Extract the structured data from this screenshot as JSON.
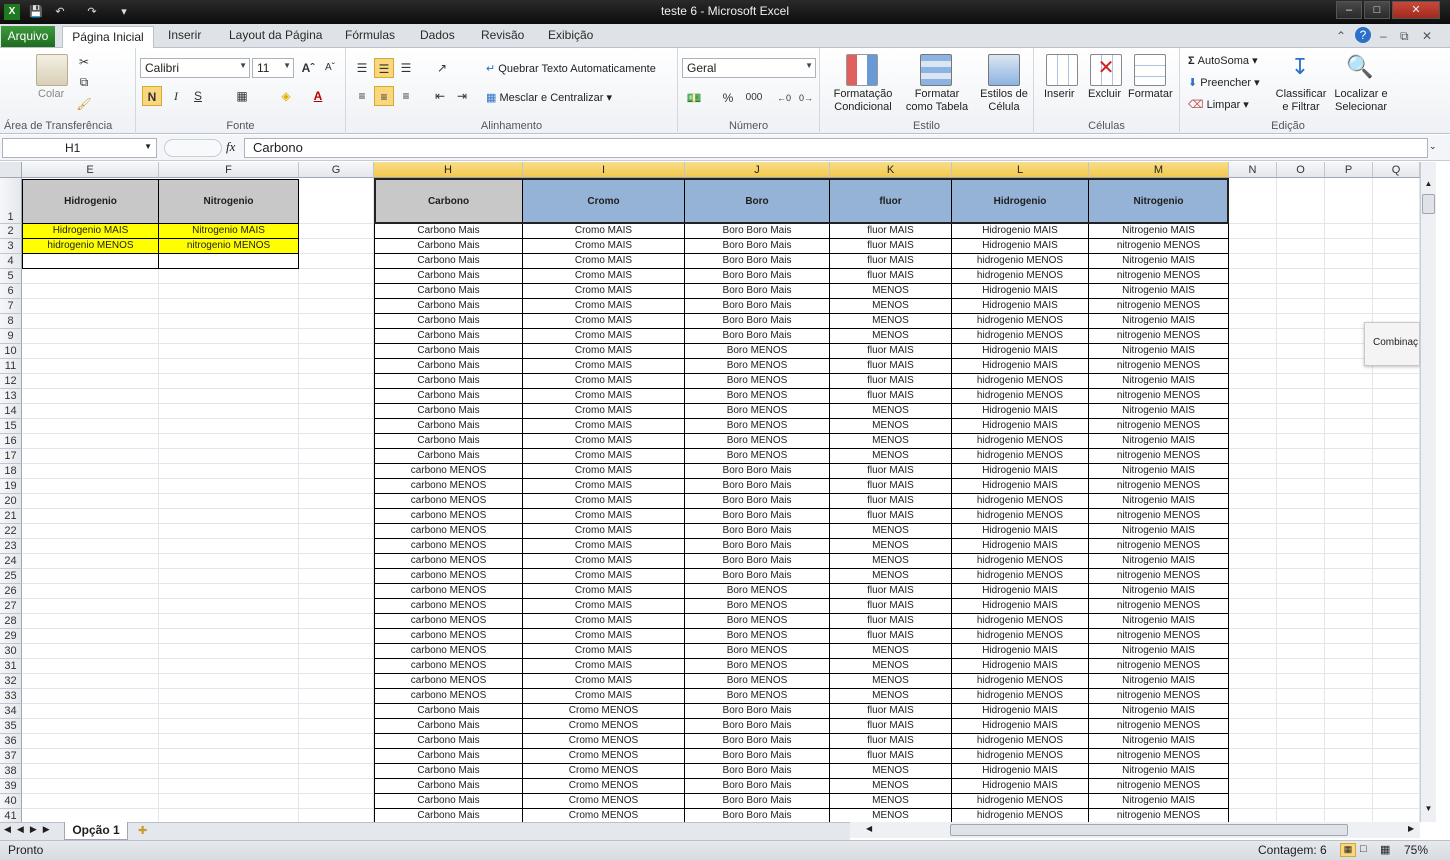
{
  "window": {
    "title": "teste 6  -  Microsoft Excel"
  },
  "tabs": [
    "Arquivo",
    "Página Inicial",
    "Inserir",
    "Layout da Página",
    "Fórmulas",
    "Dados",
    "Revisão",
    "Exibição"
  ],
  "ribbon": {
    "clipboard": {
      "label": "Área de Transferência",
      "paste": "Colar"
    },
    "font": {
      "label": "Fonte",
      "name": "Calibri",
      "size": "11",
      "bold": "N",
      "italic": "I",
      "underline": "S"
    },
    "alignment": {
      "label": "Alinhamento",
      "wrap": "Quebrar Texto Automaticamente",
      "merge": "Mesclar e Centralizar"
    },
    "number": {
      "label": "Número",
      "format": "Geral",
      "percent": "%",
      "thousands": "000"
    },
    "styles": {
      "label": "Estilo",
      "cond": [
        "Formatação",
        "Condicional"
      ],
      "table": [
        "Formatar",
        "como Tabela"
      ],
      "cell": [
        "Estilos de",
        "Célula"
      ]
    },
    "cells": {
      "label": "Células",
      "insert": "Inserir",
      "delete": "Excluir",
      "format": "Formatar"
    },
    "editing": {
      "label": "Edição",
      "autosum": "AutoSoma",
      "fill": "Preencher",
      "clear": "Limpar",
      "sort": [
        "Classificar",
        "e Filtrar"
      ],
      "find": [
        "Localizar e",
        "Selecionar"
      ]
    }
  },
  "formula_bar": {
    "name_box": "H1",
    "fx": "fx",
    "value": "Carbono"
  },
  "columns": [
    "E",
    "F",
    "G",
    "H",
    "I",
    "J",
    "K",
    "L",
    "M",
    "N",
    "O",
    "P",
    "Q"
  ],
  "left_table": {
    "headers": [
      "Hidrogenio",
      "Nitrogenio"
    ],
    "rows": [
      [
        "Hidrogenio MAIS",
        "Nitrogenio MAIS"
      ],
      [
        "hidrogenio MENOS",
        "nitrogenio MENOS"
      ]
    ]
  },
  "main_table": {
    "headers": [
      "Carbono",
      "Cromo",
      "Boro",
      "fluor",
      "Hidrogenio",
      "Nitrogenio"
    ],
    "rows": [
      [
        "Carbono Mais",
        "Cromo  MAIS",
        "Boro Boro Mais",
        "fluor MAIS",
        "Hidrogenio MAIS",
        "Nitrogenio MAIS"
      ],
      [
        "Carbono Mais",
        "Cromo  MAIS",
        "Boro Boro Mais",
        "fluor MAIS",
        "Hidrogenio MAIS",
        "nitrogenio MENOS"
      ],
      [
        "Carbono Mais",
        "Cromo  MAIS",
        "Boro Boro Mais",
        "fluor MAIS",
        "hidrogenio MENOS",
        "Nitrogenio MAIS"
      ],
      [
        "Carbono Mais",
        "Cromo  MAIS",
        "Boro Boro Mais",
        "fluor MAIS",
        "hidrogenio MENOS",
        "nitrogenio MENOS"
      ],
      [
        "Carbono Mais",
        "Cromo  MAIS",
        "Boro Boro Mais",
        "MENOS",
        "Hidrogenio MAIS",
        "Nitrogenio MAIS"
      ],
      [
        "Carbono Mais",
        "Cromo  MAIS",
        "Boro Boro Mais",
        "MENOS",
        "Hidrogenio MAIS",
        "nitrogenio MENOS"
      ],
      [
        "Carbono Mais",
        "Cromo  MAIS",
        "Boro Boro Mais",
        "MENOS",
        "hidrogenio MENOS",
        "Nitrogenio MAIS"
      ],
      [
        "Carbono Mais",
        "Cromo  MAIS",
        "Boro Boro Mais",
        "MENOS",
        "hidrogenio MENOS",
        "nitrogenio MENOS"
      ],
      [
        "Carbono Mais",
        "Cromo  MAIS",
        "Boro MENOS",
        "fluor MAIS",
        "Hidrogenio MAIS",
        "Nitrogenio MAIS"
      ],
      [
        "Carbono Mais",
        "Cromo  MAIS",
        "Boro MENOS",
        "fluor MAIS",
        "Hidrogenio MAIS",
        "nitrogenio MENOS"
      ],
      [
        "Carbono Mais",
        "Cromo  MAIS",
        "Boro MENOS",
        "fluor MAIS",
        "hidrogenio MENOS",
        "Nitrogenio MAIS"
      ],
      [
        "Carbono Mais",
        "Cromo  MAIS",
        "Boro MENOS",
        "fluor MAIS",
        "hidrogenio MENOS",
        "nitrogenio MENOS"
      ],
      [
        "Carbono Mais",
        "Cromo  MAIS",
        "Boro MENOS",
        "MENOS",
        "Hidrogenio MAIS",
        "Nitrogenio MAIS"
      ],
      [
        "Carbono Mais",
        "Cromo  MAIS",
        "Boro MENOS",
        "MENOS",
        "Hidrogenio MAIS",
        "nitrogenio MENOS"
      ],
      [
        "Carbono Mais",
        "Cromo  MAIS",
        "Boro MENOS",
        "MENOS",
        "hidrogenio MENOS",
        "Nitrogenio MAIS"
      ],
      [
        "Carbono Mais",
        "Cromo  MAIS",
        "Boro MENOS",
        "MENOS",
        "hidrogenio MENOS",
        "nitrogenio MENOS"
      ],
      [
        "carbono MENOS",
        "Cromo  MAIS",
        "Boro Boro Mais",
        "fluor MAIS",
        "Hidrogenio MAIS",
        "Nitrogenio MAIS"
      ],
      [
        "carbono MENOS",
        "Cromo  MAIS",
        "Boro Boro Mais",
        "fluor MAIS",
        "Hidrogenio MAIS",
        "nitrogenio MENOS"
      ],
      [
        "carbono MENOS",
        "Cromo  MAIS",
        "Boro Boro Mais",
        "fluor MAIS",
        "hidrogenio MENOS",
        "Nitrogenio MAIS"
      ],
      [
        "carbono MENOS",
        "Cromo  MAIS",
        "Boro Boro Mais",
        "fluor MAIS",
        "hidrogenio MENOS",
        "nitrogenio MENOS"
      ],
      [
        "carbono MENOS",
        "Cromo  MAIS",
        "Boro Boro Mais",
        "MENOS",
        "Hidrogenio MAIS",
        "Nitrogenio MAIS"
      ],
      [
        "carbono MENOS",
        "Cromo  MAIS",
        "Boro Boro Mais",
        "MENOS",
        "Hidrogenio MAIS",
        "nitrogenio MENOS"
      ],
      [
        "carbono MENOS",
        "Cromo  MAIS",
        "Boro Boro Mais",
        "MENOS",
        "hidrogenio MENOS",
        "Nitrogenio MAIS"
      ],
      [
        "carbono MENOS",
        "Cromo  MAIS",
        "Boro Boro Mais",
        "MENOS",
        "hidrogenio MENOS",
        "nitrogenio MENOS"
      ],
      [
        "carbono MENOS",
        "Cromo  MAIS",
        "Boro MENOS",
        "fluor MAIS",
        "Hidrogenio MAIS",
        "Nitrogenio MAIS"
      ],
      [
        "carbono MENOS",
        "Cromo  MAIS",
        "Boro MENOS",
        "fluor MAIS",
        "Hidrogenio MAIS",
        "nitrogenio MENOS"
      ],
      [
        "carbono MENOS",
        "Cromo  MAIS",
        "Boro MENOS",
        "fluor MAIS",
        "hidrogenio MENOS",
        "Nitrogenio MAIS"
      ],
      [
        "carbono MENOS",
        "Cromo  MAIS",
        "Boro MENOS",
        "fluor MAIS",
        "hidrogenio MENOS",
        "nitrogenio MENOS"
      ],
      [
        "carbono MENOS",
        "Cromo  MAIS",
        "Boro MENOS",
        "MENOS",
        "Hidrogenio MAIS",
        "Nitrogenio MAIS"
      ],
      [
        "carbono MENOS",
        "Cromo  MAIS",
        "Boro MENOS",
        "MENOS",
        "Hidrogenio MAIS",
        "nitrogenio MENOS"
      ],
      [
        "carbono MENOS",
        "Cromo  MAIS",
        "Boro MENOS",
        "MENOS",
        "hidrogenio MENOS",
        "Nitrogenio MAIS"
      ],
      [
        "carbono MENOS",
        "Cromo  MAIS",
        "Boro MENOS",
        "MENOS",
        "hidrogenio MENOS",
        "nitrogenio MENOS"
      ],
      [
        "Carbono Mais",
        "Cromo MENOS",
        "Boro Boro Mais",
        "fluor MAIS",
        "Hidrogenio MAIS",
        "Nitrogenio MAIS"
      ],
      [
        "Carbono Mais",
        "Cromo MENOS",
        "Boro Boro Mais",
        "fluor MAIS",
        "Hidrogenio MAIS",
        "nitrogenio MENOS"
      ],
      [
        "Carbono Mais",
        "Cromo MENOS",
        "Boro Boro Mais",
        "fluor MAIS",
        "hidrogenio MENOS",
        "Nitrogenio MAIS"
      ],
      [
        "Carbono Mais",
        "Cromo MENOS",
        "Boro Boro Mais",
        "fluor MAIS",
        "hidrogenio MENOS",
        "nitrogenio MENOS"
      ],
      [
        "Carbono Mais",
        "Cromo MENOS",
        "Boro Boro Mais",
        "MENOS",
        "Hidrogenio MAIS",
        "Nitrogenio MAIS"
      ],
      [
        "Carbono Mais",
        "Cromo MENOS",
        "Boro Boro Mais",
        "MENOS",
        "Hidrogenio MAIS",
        "nitrogenio MENOS"
      ],
      [
        "Carbono Mais",
        "Cromo MENOS",
        "Boro Boro Mais",
        "MENOS",
        "hidrogenio MENOS",
        "Nitrogenio MAIS"
      ],
      [
        "Carbono Mais",
        "Cromo MENOS",
        "Boro Boro Mais",
        "MENOS",
        "hidrogenio MENOS",
        "nitrogenio MENOS"
      ]
    ]
  },
  "row_numbers": [
    "1",
    "2",
    "3",
    "4",
    "5",
    "6",
    "7",
    "8",
    "9",
    "10",
    "11",
    "12",
    "13",
    "14",
    "15",
    "16",
    "17",
    "18",
    "19",
    "20",
    "21",
    "22",
    "23",
    "24",
    "25",
    "26",
    "27",
    "28",
    "29",
    "30",
    "31",
    "32",
    "33",
    "34",
    "35",
    "36",
    "37",
    "38",
    "39",
    "40",
    "41"
  ],
  "floating_box": "Combinaç",
  "sheet_tab": "Opção 1",
  "status": {
    "ready": "Pronto",
    "count": "Contagem: 6",
    "zoom": "75%"
  },
  "colors": {
    "header_gray": "#c8c8c8",
    "header_blue": "#95b3d7",
    "yellow": "#ffff00",
    "selected_hdr": "#f2c84b"
  }
}
